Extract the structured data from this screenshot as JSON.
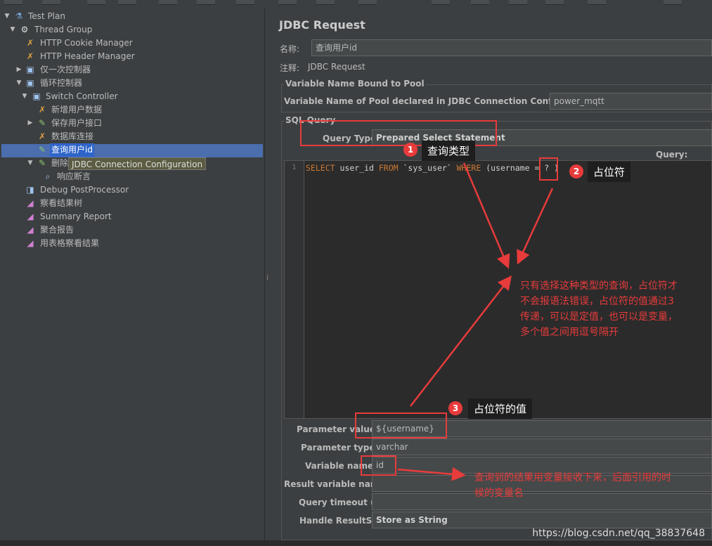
{
  "tree": {
    "nodes": [
      {
        "label": "Test Plan",
        "icon": "flask-icon",
        "arrow": "▼"
      },
      {
        "label": "Thread Group",
        "icon": "gear-icon",
        "arrow": "▼"
      },
      {
        "label": "HTTP Cookie Manager",
        "icon": "wrench-icon",
        "arrow": ""
      },
      {
        "label": "HTTP Header Manager",
        "icon": "wrench-icon",
        "arrow": ""
      },
      {
        "label": "仅一次控制器",
        "icon": "controller-icon",
        "arrow": "▶"
      },
      {
        "label": "循环控制器",
        "icon": "controller-icon",
        "arrow": "▼"
      },
      {
        "label": "Switch Controller",
        "icon": "controller-icon",
        "arrow": "▼"
      },
      {
        "label": "新增用户数据",
        "icon": "wrench-icon",
        "arrow": ""
      },
      {
        "label": "保存用户接口",
        "icon": "sampler-icon",
        "arrow": "▶"
      },
      {
        "label": "数据库连接",
        "icon": "wrench-icon",
        "arrow": ""
      },
      {
        "label": "查询用户id",
        "icon": "sampler-icon",
        "arrow": ""
      },
      {
        "label": "删除",
        "icon": "sampler-icon",
        "arrow": "▼"
      },
      {
        "label": "响应断言",
        "icon": "magnifier-icon",
        "arrow": ""
      },
      {
        "label": "Debug PostProcessor",
        "icon": "postprocessor-icon",
        "arrow": ""
      },
      {
        "label": "察看结果树",
        "icon": "listener-icon",
        "arrow": ""
      },
      {
        "label": "Summary Report",
        "icon": "listener-icon",
        "arrow": ""
      },
      {
        "label": "聚合报告",
        "icon": "listener-icon",
        "arrow": ""
      },
      {
        "label": "用表格察看结果",
        "icon": "listener-icon",
        "arrow": ""
      }
    ],
    "tooltip": "JDBC Connection Configuration"
  },
  "panel": {
    "title": "JDBC Request",
    "name_label": "名称:",
    "name_value": "查询用户id",
    "comment_label": "注释:",
    "comment_value": "JDBC Request",
    "pool_group_title": "Variable Name Bound to Pool",
    "pool_label": "Variable Name of Pool declared in JDBC Connection Configuration:",
    "pool_value": "power_mqtt",
    "sql_group_title": "SQL Query",
    "query_type_label": "Query Type:",
    "query_type_value": "Prepared Select Statement",
    "query_label": "Query:",
    "line_number": "1",
    "sql": {
      "select": "SELECT",
      "cols": " user_id ",
      "from": "FROM",
      "table": " `sys_user` ",
      "where": "WHERE",
      "cond_pre": " (username = ",
      "placeholder": "?",
      "cond_post": " )"
    },
    "param_values_label": "Parameter values:",
    "param_values_value": "${username}",
    "param_types_label": "Parameter types:",
    "param_types_value": "varchar",
    "var_names_label": "Variable names:",
    "var_names_value": "id",
    "result_var_label": "Result variable name:",
    "result_var_value": "",
    "timeout_label": "Query timeout (s):",
    "timeout_value": "",
    "handle_label": "Handle ResultSet:",
    "handle_value": "Store as String"
  },
  "annotations": {
    "badge1": "1",
    "callout1": "查询类型",
    "badge2": "2",
    "callout2": "占位符",
    "badge3": "3",
    "callout3": "占位符的值",
    "note_main_1": "只有选择这种类型的查询，占位符才",
    "note_main_2": "不会报语法错误，占位符的值通过3",
    "note_main_3": "传递，可以是定值，也可以是变量，",
    "note_main_4": "多个值之间用逗号隔开",
    "note_var_1": "查询到的结果用变量接收下来，后面引用的时",
    "note_var_2": "候的变量名",
    "accent_color": "#e83b3b"
  },
  "watermark": "https://blog.csdn.net/qq_38837648"
}
